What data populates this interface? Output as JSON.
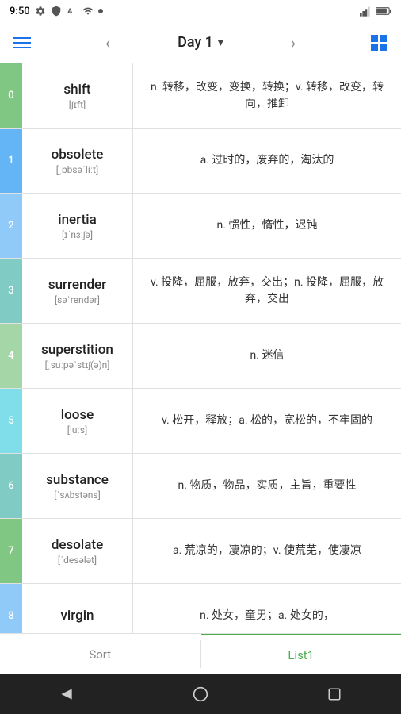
{
  "status": {
    "time": "9:50",
    "signal_icon": "signal",
    "battery_icon": "battery"
  },
  "nav": {
    "title": "Day 1",
    "chevron": "▾",
    "back_label": "‹",
    "forward_label": "›"
  },
  "words": [
    {
      "index": "0",
      "word": "shift",
      "phonetic": "[ʃɪft]",
      "definition": "n. 转移，改变，变换，转换；v. 转移，改变，转向，推卸"
    },
    {
      "index": "1",
      "word": "obsolete",
      "phonetic": "[ˌɒbsəˈliːt]",
      "definition": "a. 过时的，废弃的，淘汰的"
    },
    {
      "index": "2",
      "word": "inertia",
      "phonetic": "[ɪˈnɜːʃə]",
      "definition": "n. 惯性，惰性，迟钝"
    },
    {
      "index": "3",
      "word": "surrender",
      "phonetic": "[səˈrendər]",
      "definition": "v. 投降，屈服，放弃，交出；n. 投降，屈服，放弃，交出"
    },
    {
      "index": "4",
      "word": "superstition",
      "phonetic": "[ˌsuːpəˈstɪʃ(ə)n]",
      "definition": "n. 迷信"
    },
    {
      "index": "5",
      "word": "loose",
      "phonetic": "[luːs]",
      "definition": "v. 松开，释放；a. 松的，宽松的，不牢固的"
    },
    {
      "index": "6",
      "word": "substance",
      "phonetic": "[ˈsʌbstəns]",
      "definition": "n. 物质，物品，实质，主旨，重要性"
    },
    {
      "index": "7",
      "word": "desolate",
      "phonetic": "[ˈdesələt]",
      "definition": "a. 荒凉的，凄凉的；v. 使荒芜，使凄凉"
    },
    {
      "index": "8",
      "word": "virgin",
      "phonetic": "",
      "definition": "n. 处女，童男；a. 处女的，"
    }
  ],
  "tabs": {
    "sort_label": "Sort",
    "list_label": "List1"
  },
  "android_nav": {
    "back": "◁",
    "home": "○",
    "recent": "□"
  }
}
